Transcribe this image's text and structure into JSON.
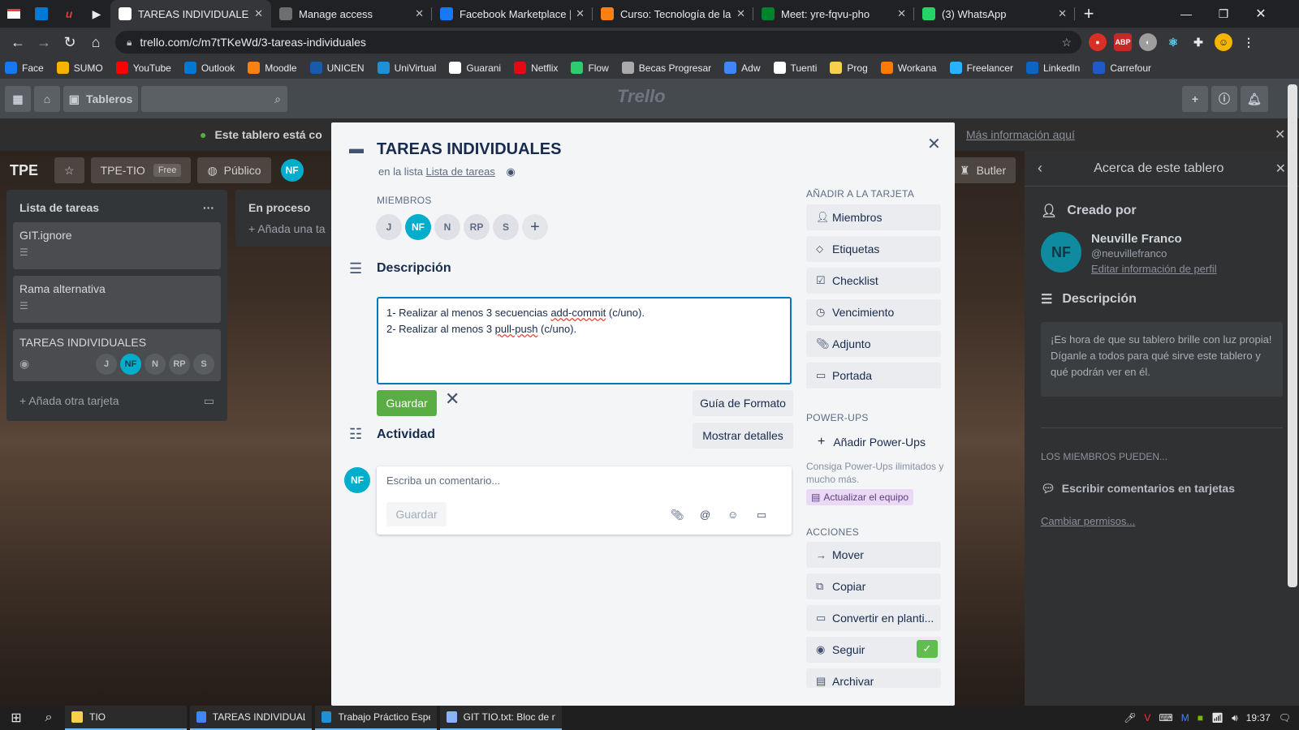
{
  "browser": {
    "tabs": [
      {
        "label": "TAREAS INDIVIDUALES en",
        "icon": "trello",
        "color": "#ffffff",
        "active": true
      },
      {
        "label": "Manage access",
        "icon": "github",
        "color": "#6e6e6e"
      },
      {
        "label": "Facebook Marketplace | F",
        "icon": "facebook",
        "color": "#1877f2"
      },
      {
        "label": "Curso: Tecnología de la Inf",
        "icon": "moodle",
        "color": "#f98012"
      },
      {
        "label": "Meet: yre-fqvu-pho",
        "icon": "meet",
        "color": "#00832d"
      },
      {
        "label": "(3) WhatsApp",
        "icon": "whatsapp",
        "color": "#25d366"
      }
    ],
    "url": "trello.com/c/m7tTKeWd/3-tareas-individuales",
    "bookmarks": [
      {
        "label": "Face",
        "color": "#1877f2"
      },
      {
        "label": "SUMO",
        "color": "#f5b400"
      },
      {
        "label": "YouTube",
        "color": "#ff0000"
      },
      {
        "label": "Outlook",
        "color": "#0078d4"
      },
      {
        "label": "Moodle",
        "color": "#f98012"
      },
      {
        "label": "UNICEN",
        "color": "#1a5aa6"
      },
      {
        "label": "UniVirtual",
        "color": "#1f8fd6"
      },
      {
        "label": "Guarani",
        "color": "#ffffff"
      },
      {
        "label": "Netflix",
        "color": "#e50914"
      },
      {
        "label": "Flow",
        "color": "#2ecc71"
      },
      {
        "label": "Becas Progresar",
        "color": "#aaaaaa"
      },
      {
        "label": "Adw",
        "color": "#4285f4"
      },
      {
        "label": "Tuenti",
        "color": "#ffffff"
      },
      {
        "label": "Prog",
        "color": "#f7d14c"
      },
      {
        "label": "Workana",
        "color": "#ff7a00"
      },
      {
        "label": "Freelancer",
        "color": "#29b2fe"
      },
      {
        "label": "LinkedIn",
        "color": "#0a66c2"
      },
      {
        "label": "Carrefour",
        "color": "#1e5bc6"
      }
    ]
  },
  "trello": {
    "header_boards": "Tableros",
    "logo": "Trello",
    "banner_text": "Este tablero está co",
    "banner_link": "Más información aquí",
    "board_name": "TPE",
    "team": "TPE-TIO",
    "team_badge": "Free",
    "visibility": "Público",
    "butler": "Butler",
    "lists": [
      {
        "title": "Lista de tareas",
        "cards": [
          {
            "title": "GIT.ignore"
          },
          {
            "title": "Rama alternativa"
          },
          {
            "title": "TAREAS INDIVIDUALES"
          }
        ],
        "add_label": "Añada otra tarjeta"
      },
      {
        "title": "En proceso",
        "add_label": "Añada una ta"
      }
    ],
    "side_panel": {
      "title": "Acerca de este tablero",
      "created_by_label": "Creado por",
      "creator_name": "Neuville Franco",
      "creator_user": "@neuvillefranco",
      "edit_profile": "Editar información de perfil",
      "description_label": "Descripción",
      "description": "¡Es hora de que su tablero brille con luz propia! Díganle a todos para qué sirve este tablero y qué podrán ver en él.",
      "members_can": "LOS MIEMBROS PUEDEN...",
      "comments": "Escribir comentarios en tarjetas",
      "change_perms": "Cambiar permisos..."
    }
  },
  "modal": {
    "title": "TAREAS INDIVIDUALES",
    "in_list_prefix": "en la lista",
    "in_list_name": "Lista de tareas",
    "members_label": "MIEMBROS",
    "members": [
      "J",
      "NF",
      "N",
      "RP",
      "S"
    ],
    "description_label": "Descripción",
    "description": {
      "line1_a": "1- Realizar al menos 3 secuencias ",
      "line1_u": "add-commit",
      "line1_b": " (c/uno).",
      "line2_a": "2- Realizar al menos 3 ",
      "line2_u": "pull-push",
      "line2_b": " (c/uno)."
    },
    "save": "Guardar",
    "format_guide": "Guía de Formato",
    "activity_label": "Actividad",
    "show_details": "Mostrar detalles",
    "comment_placeholder": "Escriba un comentario...",
    "comment_save": "Guardar",
    "user_initials": "NF",
    "sidebar": {
      "add_to_card": "AÑADIR A LA TARJETA",
      "add_items": [
        "Miembros",
        "Etiquetas",
        "Checklist",
        "Vencimiento",
        "Adjunto",
        "Portada"
      ],
      "powerups_label": "POWER-UPS",
      "add_powerups": "Añadir Power-Ups",
      "powerups_note": "Consiga Power-Ups ilimitados y mucho más.",
      "upgrade": "Actualizar el equipo",
      "actions_label": "ACCIONES",
      "actions": [
        "Mover",
        "Copiar",
        "Convertir en planti...",
        "Seguir",
        "Archivar"
      ]
    }
  },
  "taskbar": {
    "items": [
      {
        "label": "TIO",
        "color": "#f7d14c"
      },
      {
        "label": "TAREAS INDIVIDUALE...",
        "color": "#4285f4"
      },
      {
        "label": "Trabajo Práctico Espe...",
        "color": "#1f8fd6"
      },
      {
        "label": "GIT TIO.txt: Bloc de n...",
        "color": "#8ab4f8"
      }
    ],
    "time": "19:37"
  }
}
